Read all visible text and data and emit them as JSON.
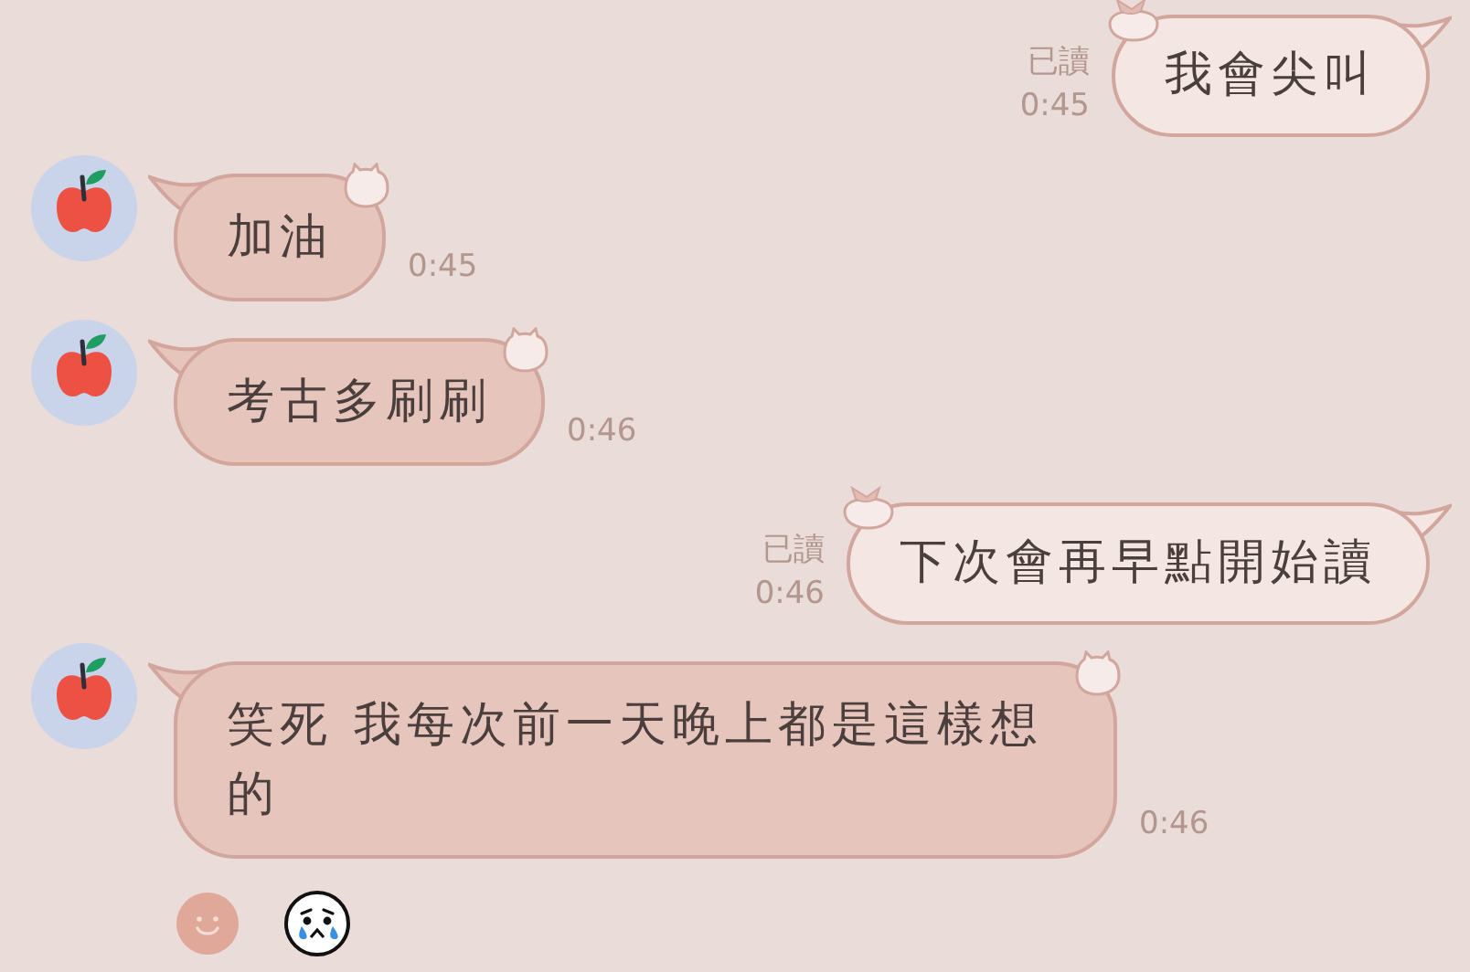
{
  "messages": [
    {
      "kind": "sent",
      "text": "我會尖叫",
      "read_label": "已讀",
      "time": "0:45"
    },
    {
      "kind": "received",
      "text": "加油",
      "time": "0:45"
    },
    {
      "kind": "received",
      "text": "考古多刷刷",
      "time": "0:46"
    },
    {
      "kind": "sent",
      "text": "下次會再早點開始讀",
      "read_label": "已讀",
      "time": "0:46"
    },
    {
      "kind": "received",
      "text": "笑死 我每次前一天晚上都是這樣想的",
      "time": "0:46",
      "reacted": true
    }
  ]
}
